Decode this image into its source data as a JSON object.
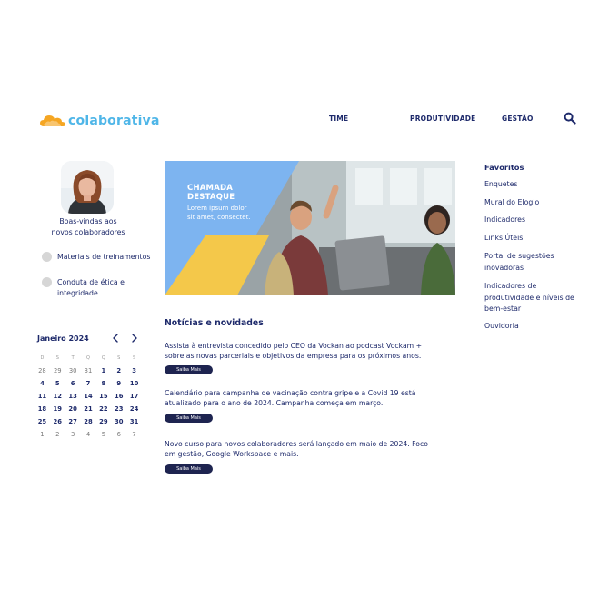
{
  "brand": {
    "name": "colaborativa",
    "color": "#4fb6e8",
    "cloud_color": "#f5a623"
  },
  "nav": {
    "items": [
      "TIME",
      "PRODUTIVIDADE",
      "GESTÃO"
    ],
    "search_icon": "search-icon"
  },
  "profile": {
    "welcome_line1": "Boas-vindas aos",
    "welcome_line2": "novos colaboradores"
  },
  "sidebar": {
    "items": [
      {
        "line1": "Materiais de treinamentos",
        "line2": ""
      },
      {
        "line1": "Conduta de ética e",
        "line2": "integridade"
      }
    ]
  },
  "calendar": {
    "title": "Janeiro 2024",
    "weekdays": [
      "D",
      "S",
      "T",
      "Q",
      "Q",
      "S",
      "S"
    ],
    "weeks": [
      [
        "28",
        "29",
        "30",
        "31",
        "1",
        "2",
        "3"
      ],
      [
        "4",
        "5",
        "6",
        "7",
        "8",
        "9",
        "10"
      ],
      [
        "11",
        "12",
        "13",
        "14",
        "15",
        "16",
        "17"
      ],
      [
        "18",
        "19",
        "20",
        "21",
        "22",
        "23",
        "24"
      ],
      [
        "25",
        "26",
        "27",
        "28",
        "29",
        "30",
        "31"
      ],
      [
        "1",
        "2",
        "3",
        "4",
        "5",
        "6",
        "7"
      ]
    ]
  },
  "banner": {
    "title_line1": "CHAMADA",
    "title_line2": "DESTAQUE",
    "text_line1": "Lorem ipsum dolor",
    "text_line2": "sit amet, consectet.",
    "panel_color": "#7db4f0",
    "accent_color": "#f4c84a"
  },
  "news": {
    "title": "Notícias e novidades",
    "button_label": "Saiba Mais",
    "items": [
      {
        "line1": "Assista à entrevista concedido pelo CEO da Vockan ao podcast Vockam +",
        "line2": "sobre as novas parceriais e objetivos da empresa para os próximos anos."
      },
      {
        "line1": "Calendário para campanha de vacinação contra  gripe e a Covid 19 está",
        "line2": "atualizado para o ano de 2024. Campanha começa em março."
      },
      {
        "line1": "Novo curso para novos colaboradores será lançado em maio de 2024. Foco",
        "line2": "em gestão, Google Workspace e mais."
      }
    ]
  },
  "favorites": {
    "title": "Favoritos",
    "items": [
      {
        "line1": "Enquetes",
        "line2": "",
        "line3": ""
      },
      {
        "line1": "Mural do Elogio",
        "line2": "",
        "line3": ""
      },
      {
        "line1": "Indicadores",
        "line2": "",
        "line3": ""
      },
      {
        "line1": "Links Úteis",
        "line2": "",
        "line3": ""
      },
      {
        "line1": "Portal de sugestões",
        "line2": "inovadoras",
        "line3": ""
      },
      {
        "line1": "Indicadores de",
        "line2": "produtividade e níveis de",
        "line3": "bem-estar"
      },
      {
        "line1": "Ouvidoria",
        "line2": "",
        "line3": ""
      }
    ]
  }
}
